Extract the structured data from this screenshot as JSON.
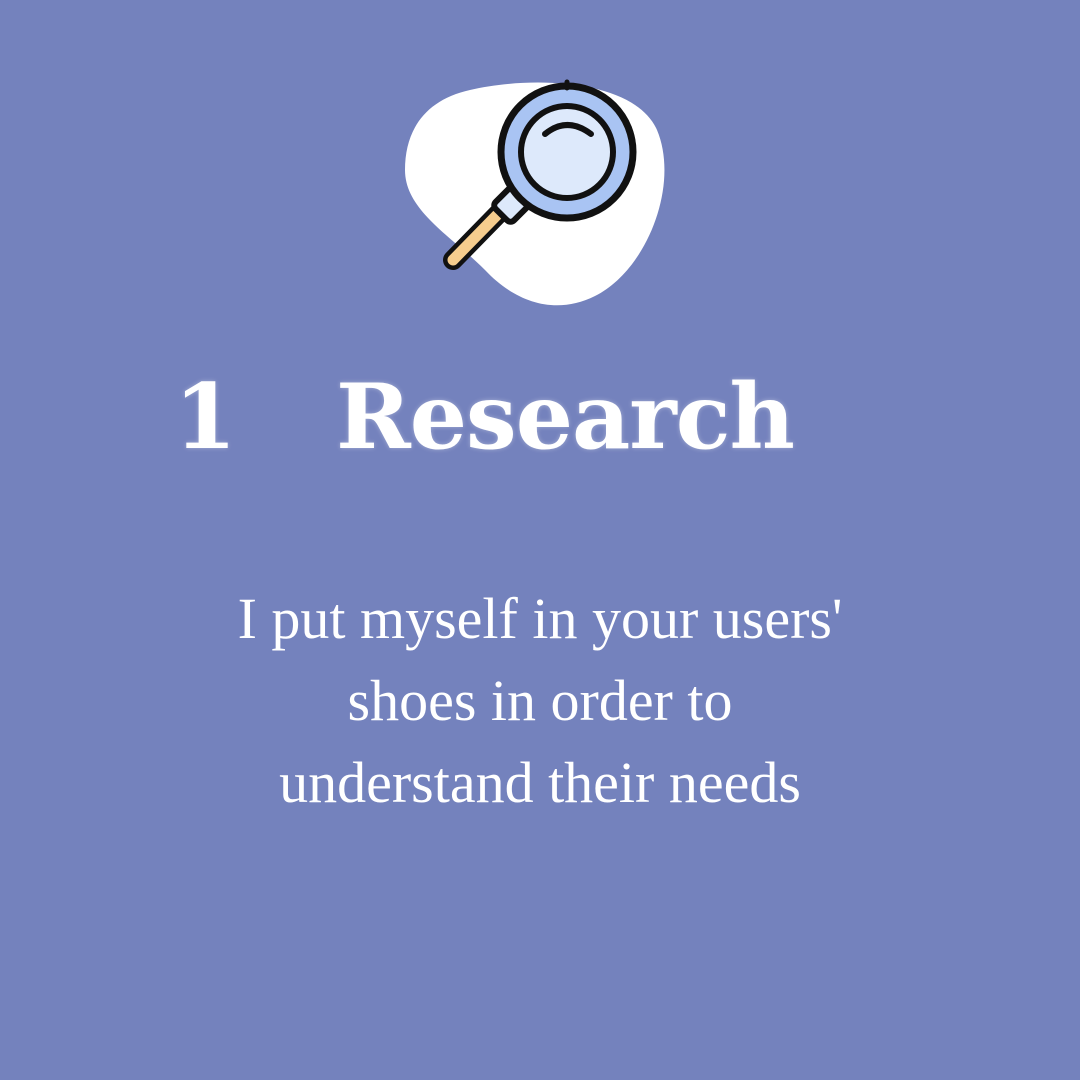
{
  "slide": {
    "background_color": "#7482bd",
    "icon": "magnifying-glass-icon",
    "step_number": "1",
    "step_title": "Research",
    "description_lines": [
      "I put myself in your users'",
      "shoes in order to",
      "understand their needs"
    ]
  },
  "colors": {
    "blob": "#ffffff",
    "lens_rim": "#a9c4f3",
    "lens_glass": "#dde9fb",
    "handle": "#f6cd8e",
    "outline": "#111111",
    "text": "#ffffff"
  }
}
